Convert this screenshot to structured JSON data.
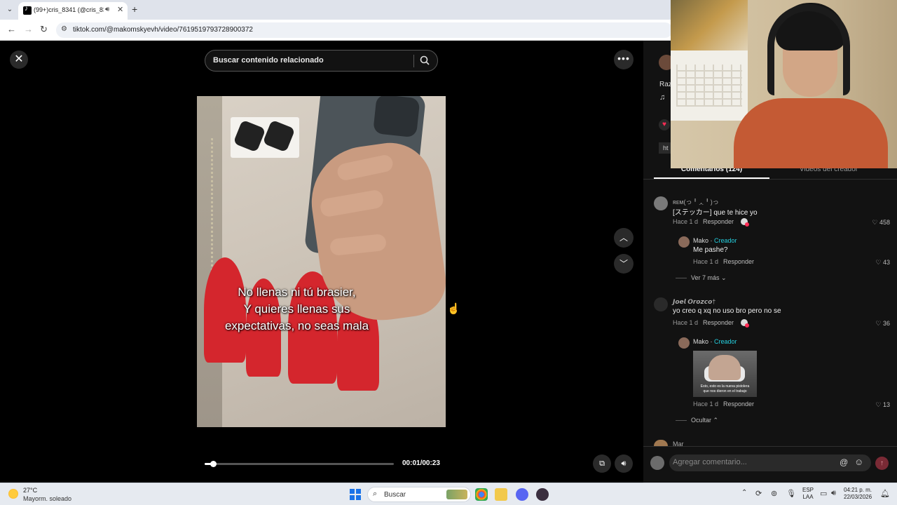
{
  "browser": {
    "tab_title": "(99+)cris_8341 (@cris_8341",
    "url": "tiktok.com/@makomskyevh/video/7619519793728900372"
  },
  "player": {
    "search_placeholder": "Buscar contenido relacionado",
    "caption_lines": [
      "No llenas ni tú brasier,",
      "Y quieres llenas sus",
      "expectativas, no seas mala"
    ],
    "time": "00:01/00:23",
    "progress": 0.043
  },
  "side": {
    "author_fragment": "Raz",
    "link_fragment": "ht"
  },
  "panel": {
    "tab_comments": "Comentarios (124)",
    "tab_videos": "Videos del creador"
  },
  "comments": [
    {
      "name": "ʀᴇᴍ(っ╹ᆺ╹)っ",
      "text": "[ステッカー] que te hice yo",
      "time": "Hace 1 d",
      "reply": "Responder",
      "likes": "458",
      "replies": [
        {
          "name": "Mako",
          "badge": "Creador",
          "text": "Me pashe?",
          "time": "Hace 1 d",
          "reply": "Responder",
          "likes": "43"
        }
      ],
      "more": "Ver 7 más"
    },
    {
      "name": "𝙅𝙤𝙚𝙡 𝙊𝙧𝙤𝙯𝙘𝙤†",
      "text": "yo creo q xq no uso bro pero no se",
      "time": "Hace 1 d",
      "reply": "Responder",
      "likes": "36",
      "replies": [
        {
          "name": "Mako",
          "badge": "Creador",
          "image_caption": [
            "Esto, esto es la nueva pistolera",
            "que nos dieron en el trabajo"
          ],
          "time": "Hace 1 d",
          "reply": "Responder",
          "likes": "13"
        }
      ],
      "more": "Ocultar"
    },
    {
      "name": "Mar"
    }
  ],
  "composer": {
    "placeholder": "Agregar comentario..."
  },
  "taskbar": {
    "weather_temp": "27°C",
    "weather_desc": "Mayorm. soleado",
    "search": "Buscar",
    "lang_1": "ESP",
    "lang_2": "LAA",
    "time": "04:21 p. m.",
    "date": "22/03/2026"
  },
  "colors": {
    "accent": "#fe2c55",
    "creator_badge": "#25d0e0"
  }
}
